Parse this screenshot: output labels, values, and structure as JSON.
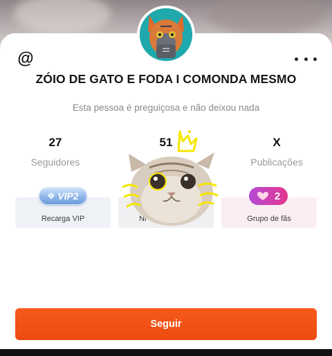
{
  "profile": {
    "name": "ZÓIO DE GATO E FODA I COMONDA MESMO",
    "bio": "Esta pessoa é preguiçosa e não deixou nada",
    "at_symbol": "@"
  },
  "stats": [
    {
      "value": "27",
      "label": "Seguidores"
    },
    {
      "value": "51",
      "label": ""
    },
    {
      "value": "X",
      "label": "Publicações"
    }
  ],
  "tiles": {
    "vip": {
      "badge": "VIP2",
      "label": "Recarga VIP"
    },
    "middle": {
      "label": "Ni"
    },
    "fans": {
      "badge_count": "2",
      "label": "Grupo de fãs"
    }
  },
  "actions": {
    "follow_label": "Seguir"
  },
  "colors": {
    "accent": "#ee4a0f",
    "fan_badge_start": "#b44bd6",
    "fan_badge_end": "#e3378e",
    "vip_badge": "#8fb6ea",
    "sticker_scribble": "#f5e600"
  },
  "icons": {
    "top_left": "at-icon",
    "top_right": "more-options-icon",
    "vip": "diamond-icon",
    "fans": "heart-icon"
  }
}
